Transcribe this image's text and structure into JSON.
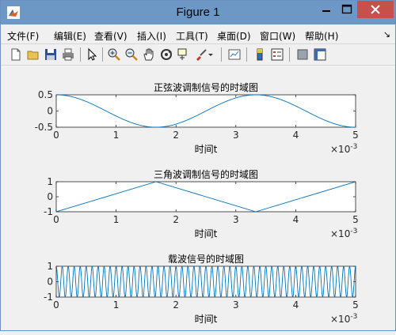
{
  "window": {
    "title": "Figure 1"
  },
  "menu": [
    "文件(F)",
    "编辑(E)",
    "查看(V)",
    "插入(I)",
    "工具(T)",
    "桌面(D)",
    "窗口(W)",
    "帮助(H)"
  ],
  "toolbar": {
    "icons": [
      "new-figure-icon",
      "open-file-icon",
      "save-icon",
      "print-icon",
      "edit-plot-arrow-icon",
      "zoom-in-icon",
      "zoom-out-icon",
      "pan-hand-icon",
      "rotate-3d-icon",
      "data-cursor-icon",
      "brush-icon",
      "link-plot-icon",
      "colorbar-icon",
      "legend-icon",
      "hide-plot-tools-icon",
      "show-plot-tools-icon"
    ]
  },
  "colors": {
    "line": "#0072bd",
    "titlebar": "#6d98c6",
    "close": "#c7504a"
  },
  "chart_data": [
    {
      "type": "line",
      "title": "正弦波调制信号的时域图",
      "xlabel": "时间t",
      "x_exponent": "×10-3",
      "xlim": [
        0,
        5
      ],
      "ylim": [
        -0.5,
        0.5
      ],
      "xticks": [
        "0",
        "1",
        "2",
        "3",
        "4",
        "5"
      ],
      "yticks": [
        "0.5",
        "0",
        "-0.5"
      ],
      "series": [
        {
          "function": "0.5*cos(2*pi*300*t)",
          "x_range": [
            0,
            5
          ]
        }
      ]
    },
    {
      "type": "line",
      "title": "三角波调制信号的时域图",
      "xlabel": "时间t",
      "x_exponent": "×10-3",
      "xlim": [
        0,
        5
      ],
      "ylim": [
        -1,
        1
      ],
      "xticks": [
        "0",
        "1",
        "2",
        "3",
        "4",
        "5"
      ],
      "yticks": [
        "1",
        "0",
        "-1"
      ],
      "series": [
        {
          "x": [
            0,
            1.667,
            3.333,
            5
          ],
          "y": [
            -1,
            1,
            -1,
            1
          ]
        }
      ]
    },
    {
      "type": "line",
      "title": "载波信号的时域图",
      "xlabel": "时间t",
      "x_exponent": "×10-3",
      "xlim": [
        0,
        5
      ],
      "ylim": [
        -1,
        1
      ],
      "xticks": [
        "0",
        "1",
        "2",
        "3",
        "4",
        "5"
      ],
      "yticks": [
        "1",
        "0",
        "-1"
      ],
      "series": [
        {
          "function": "cos(2*pi*10000*t)",
          "x_range": [
            0,
            5
          ]
        }
      ]
    }
  ]
}
